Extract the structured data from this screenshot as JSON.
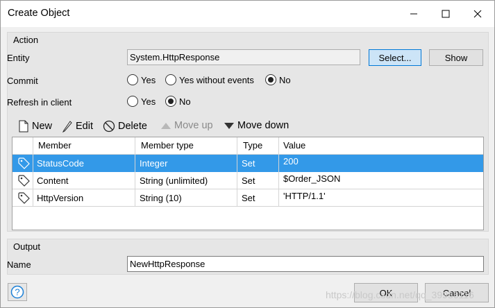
{
  "window": {
    "title": "Create Object"
  },
  "action": {
    "group_label": "Action",
    "entity": {
      "label": "Entity",
      "value": "System.HttpResponse",
      "select_label": "Select...",
      "show_label": "Show"
    },
    "commit": {
      "label": "Commit",
      "options": [
        "Yes",
        "Yes without events",
        "No"
      ],
      "selected": "No"
    },
    "refresh": {
      "label": "Refresh in client",
      "options": [
        "Yes",
        "No"
      ],
      "selected": "No"
    },
    "toolbar": {
      "new_label": "New",
      "edit_label": "Edit",
      "delete_label": "Delete",
      "move_up_label": "Move up",
      "move_down_label": "Move down"
    },
    "table": {
      "columns": [
        "Member",
        "Member type",
        "Type",
        "Value"
      ],
      "rows": [
        {
          "member": "StatusCode",
          "member_type": "Integer",
          "type": "Set",
          "value": "200",
          "selected": true
        },
        {
          "member": "Content",
          "member_type": "String (unlimited)",
          "type": "Set",
          "value": "$Order_JSON",
          "selected": false
        },
        {
          "member": "HttpVersion",
          "member_type": "String (10)",
          "type": "Set",
          "value": "'HTTP/1.1'",
          "selected": false
        }
      ]
    }
  },
  "output": {
    "group_label": "Output",
    "name_label": "Name",
    "name_value": "NewHttpResponse"
  },
  "footer": {
    "ok_label": "OK",
    "cancel_label": "Cancel",
    "help_icon": "question-icon"
  },
  "watermark": "https://blog.csdn.net/qq_39936116",
  "colors": {
    "selection": "#3399e8",
    "accent": "#0078d7"
  }
}
